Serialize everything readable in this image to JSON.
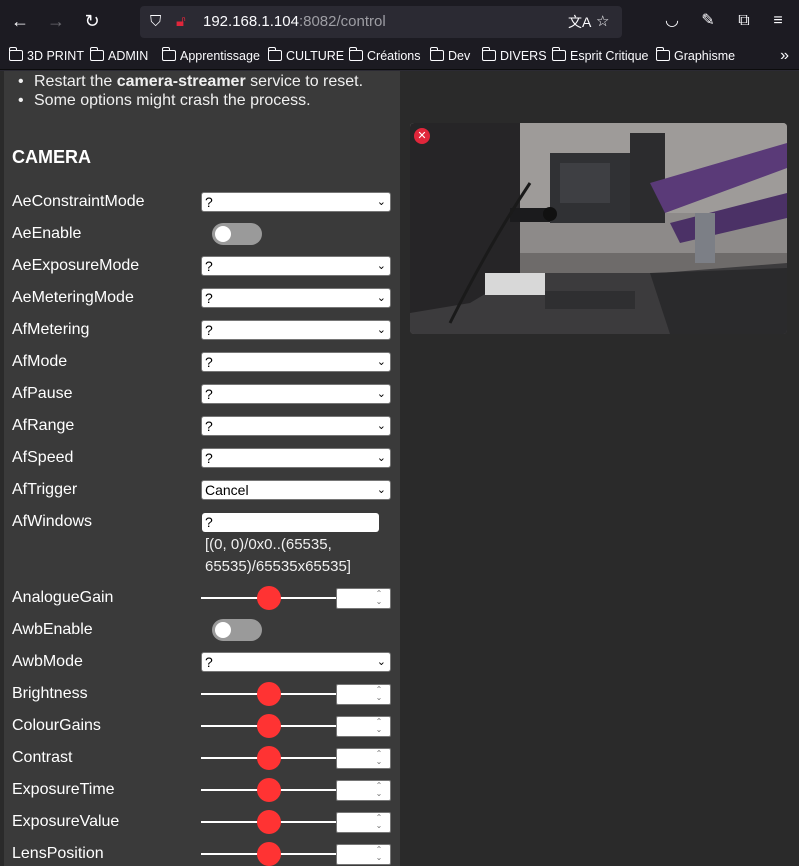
{
  "browser": {
    "url_host": "192.168.1.104",
    "url_rest": ":8082/control",
    "bookmarks": [
      "3D PRINT",
      "ADMIN",
      "Apprentissage",
      "CULTURE",
      "Créations",
      "Dev",
      "DIVERS",
      "Esprit Critique",
      "Graphisme"
    ]
  },
  "notes": {
    "restart_prefix": "Restart the ",
    "restart_service": "camera-streamer",
    "restart_suffix": " service to reset.",
    "crash": "Some options might crash the process."
  },
  "section_title": "CAMERA",
  "controls": {
    "ae_constraint_mode": {
      "label": "AeConstraintMode",
      "value": "?"
    },
    "ae_enable": {
      "label": "AeEnable",
      "checked": false
    },
    "ae_exposure_mode": {
      "label": "AeExposureMode",
      "value": "?"
    },
    "ae_metering_mode": {
      "label": "AeMeteringMode",
      "value": "?"
    },
    "af_metering": {
      "label": "AfMetering",
      "value": "?"
    },
    "af_mode": {
      "label": "AfMode",
      "value": "?"
    },
    "af_pause": {
      "label": "AfPause",
      "value": "?"
    },
    "af_range": {
      "label": "AfRange",
      "value": "?"
    },
    "af_speed": {
      "label": "AfSpeed",
      "value": "?"
    },
    "af_trigger": {
      "label": "AfTrigger",
      "value": "Cancel"
    },
    "af_windows": {
      "label": "AfWindows",
      "value": "?",
      "hint": "[(0, 0)/0x0..(65535, 65535)/65535x65535]"
    },
    "analogue_gain": {
      "label": "AnalogueGain",
      "level": 0.5
    },
    "awb_enable": {
      "label": "AwbEnable",
      "checked": false
    },
    "awb_mode": {
      "label": "AwbMode",
      "value": "?"
    },
    "brightness": {
      "label": "Brightness",
      "level": 0.5
    },
    "colour_gains": {
      "label": "ColourGains",
      "level": 0.5
    },
    "contrast": {
      "label": "Contrast",
      "level": 0.5
    },
    "exposure_time": {
      "label": "ExposureTime",
      "level": 0.5
    },
    "exposure_value": {
      "label": "ExposureValue",
      "level": 0.5
    },
    "lens_position": {
      "label": "LensPosition",
      "level": 0.5
    }
  },
  "colors": {
    "accent": "#ff3333",
    "panel": "#3a3a3a",
    "close": "#e0263b"
  }
}
